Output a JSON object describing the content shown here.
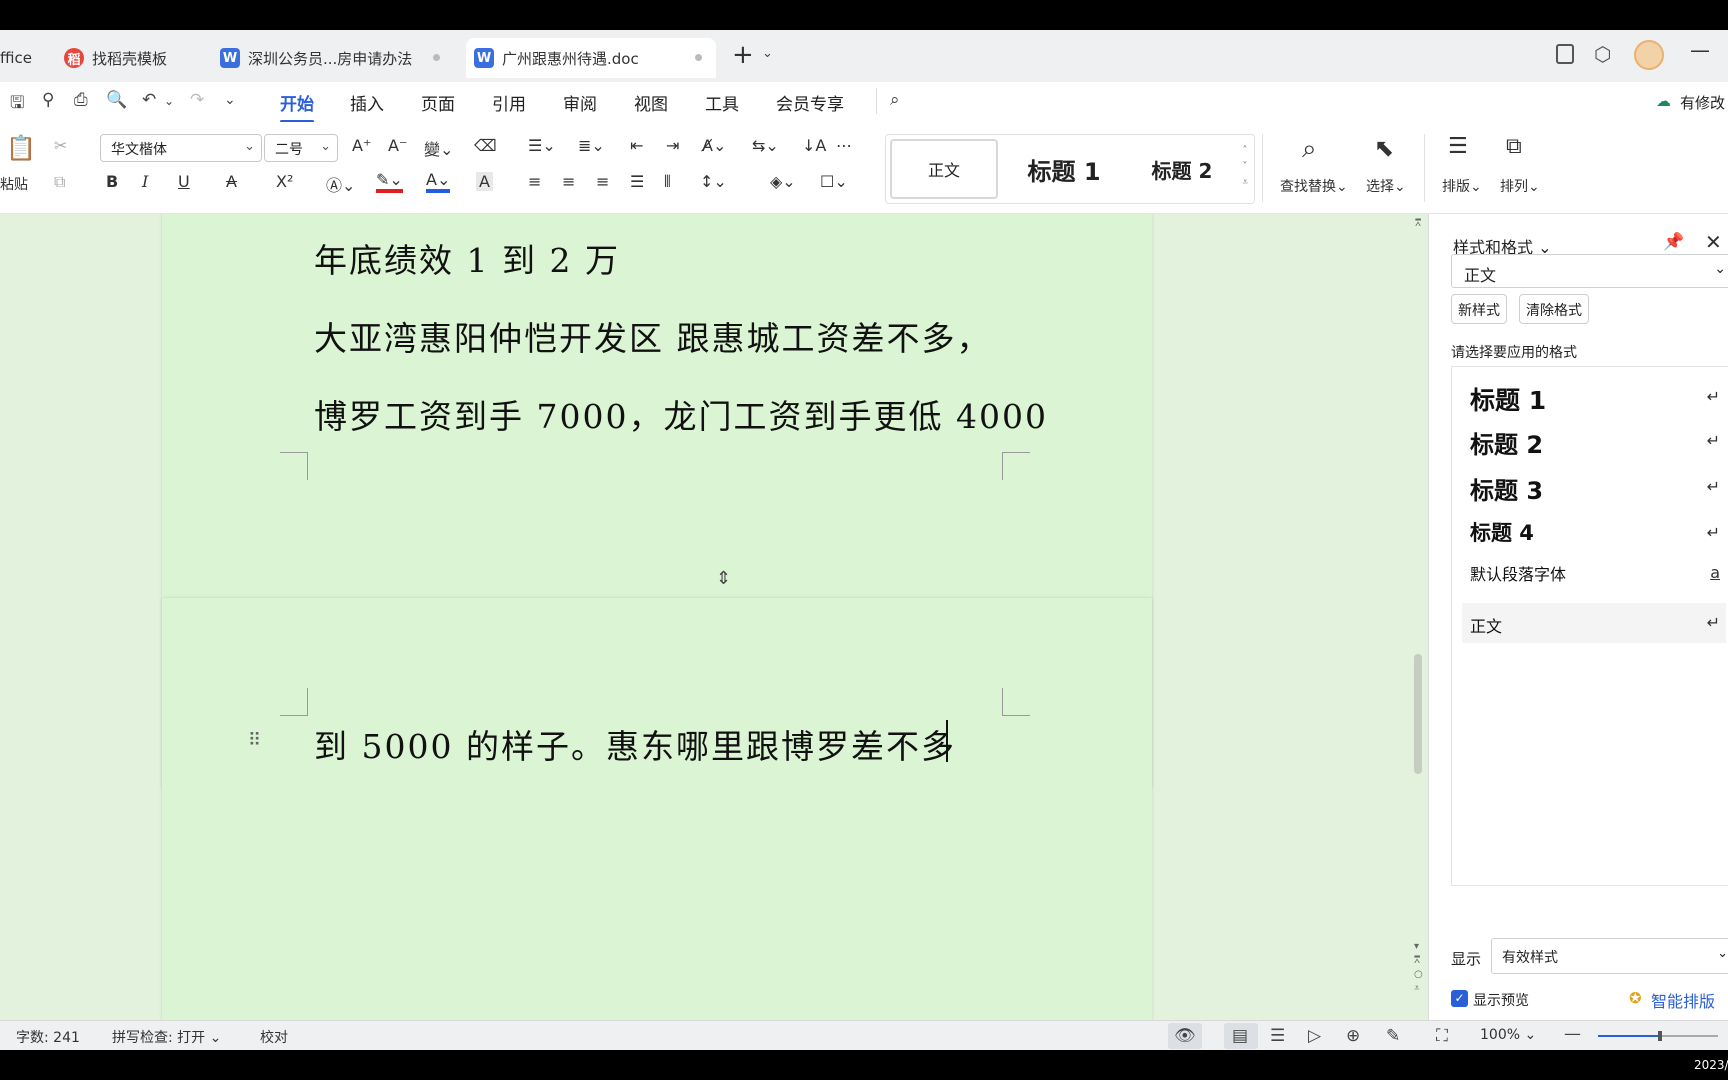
{
  "tabs": [
    {
      "label": "ffice",
      "icon": "office-icon"
    },
    {
      "label": "找稻壳模板",
      "icon": "docer-icon"
    },
    {
      "label": "深圳公务员...房申请办法",
      "icon": "word-icon"
    },
    {
      "label": "广州跟惠州待遇.doc",
      "icon": "word-icon",
      "active": true
    }
  ],
  "new_tab": "+",
  "menu": [
    "开始",
    "插入",
    "页面",
    "引用",
    "审阅",
    "视图",
    "工具",
    "会员专享"
  ],
  "modify_label": "有修改",
  "ribbon": {
    "paste": "粘贴",
    "font_name": "华文楷体",
    "font_size": "二号",
    "bold": "B",
    "italic": "I",
    "underline": "U",
    "strike": "A",
    "superscript": "X²",
    "style_normal": "正文",
    "style_h1": "标题 1",
    "style_h2": "标题 2",
    "find_replace": "查找替换",
    "select": "选择",
    "layout": "排版",
    "arrange": "排列"
  },
  "document": {
    "page1_lines": [
      "年底绩效 1 到 2 万",
      "大亚湾惠阳仲恺开发区 跟惠城工资差不多，",
      "博罗工资到手 7000，龙门工资到手更低 4000"
    ],
    "page2_lines": [
      "到 5000 的样子。惠东哪里跟博罗差不多"
    ]
  },
  "panel": {
    "title": "样式和格式",
    "current_style": "正文",
    "new_style": "新样式",
    "clear_format": "清除格式",
    "prompt": "请选择要应用的格式",
    "styles": [
      {
        "label": "标题 1",
        "mark": "↵"
      },
      {
        "label": "标题 2",
        "mark": "↵"
      },
      {
        "label": "标题 3",
        "mark": "↵"
      },
      {
        "label": "标题 4",
        "mark": "↵"
      },
      {
        "label": "默认段落字体",
        "mark": "a"
      },
      {
        "label": "正文",
        "mark": "↵"
      }
    ],
    "show_label": "显示",
    "show_value": "有效样式",
    "preview_label": "显示预览",
    "smart_layout": "智能排版"
  },
  "status": {
    "word_count": "字数: 241",
    "spell_check": "拼写检查: 打开",
    "proofread": "校对",
    "zoom": "100%"
  },
  "clock_fragment": "2023/",
  "colors": {
    "accent": "#2a5fd9",
    "doc_bg": "#e2f2dc",
    "page_bg": "#dbf4d4",
    "highlight_red": "#e02020",
    "font_blue": "#1f5fe0"
  }
}
